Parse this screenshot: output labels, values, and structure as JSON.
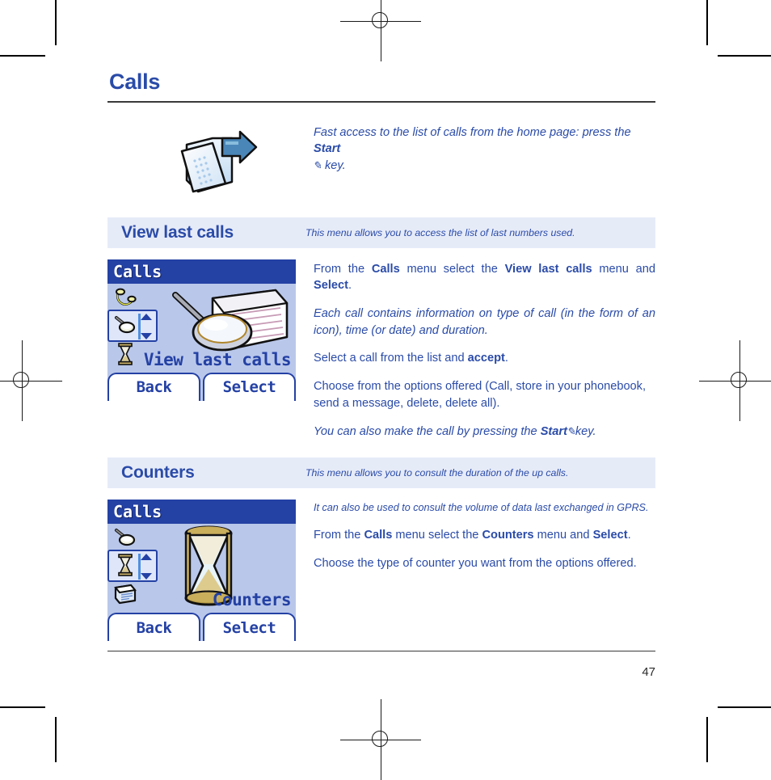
{
  "document": {
    "chapter_title": "Calls",
    "page_number": "47"
  },
  "intro": {
    "icon": "folder-arrow-icon",
    "text_part1": "Fast access to the list of calls from the home page: press the ",
    "text_bold": "Start",
    "text_part2": " ",
    "pen_glyph": "✎",
    "text_part3": " key."
  },
  "sections": [
    {
      "id": "view-last-calls",
      "band_title": "View last calls",
      "band_subtitle": "This menu allows you to access the list of last numbers used.",
      "screen": {
        "title": "Calls",
        "label": "View last calls",
        "rail_icons": [
          "handset-ring-icon",
          "phone-handset-icon",
          "hourglass-icon"
        ],
        "selected_index": 1,
        "center_icon": "magnifier-list-icon",
        "softkey_left": "Back",
        "softkey_right": "Select"
      },
      "paragraphs": [
        {
          "style": "normal-justify",
          "runs": [
            {
              "t": "From the ",
              "b": false
            },
            {
              "t": "Calls",
              "b": true
            },
            {
              "t": " menu select the ",
              "b": false
            },
            {
              "t": "View last calls",
              "b": true
            },
            {
              "t": " menu and ",
              "b": false
            },
            {
              "t": "Select",
              "b": true
            },
            {
              "t": ".",
              "b": false
            }
          ]
        },
        {
          "style": "italic-justify",
          "runs": [
            {
              "t": "Each call contains information on type of call (in the form of an icon), time (or date) and duration.",
              "b": false
            }
          ]
        },
        {
          "style": "normal",
          "runs": [
            {
              "t": "Select a call from the list and ",
              "b": false
            },
            {
              "t": "accept",
              "b": true
            },
            {
              "t": ".",
              "b": false
            }
          ]
        },
        {
          "style": "normal",
          "runs": [
            {
              "t": "Choose from the options offered (Call, store in your phonebook, send a message, delete, delete all).",
              "b": false
            }
          ]
        },
        {
          "style": "italic-key",
          "runs": [
            {
              "t": "You can also make the call by pressing the ",
              "b": false
            },
            {
              "t": "Start",
              "b": true
            },
            {
              "t": " ✎ ",
              "b": false
            },
            {
              "t": "key.",
              "b": false
            }
          ]
        }
      ]
    },
    {
      "id": "counters",
      "band_title": "Counters",
      "band_subtitle": "This menu allows you to consult the duration of the up calls.",
      "screen": {
        "title": "Calls",
        "label": "Counters",
        "rail_icons": [
          "phone-handset-icon",
          "hourglass-icon",
          "notepad-icon"
        ],
        "selected_index": 1,
        "center_icon": "hourglass-icon",
        "softkey_left": "Back",
        "softkey_right": "Select"
      },
      "paragraphs": [
        {
          "style": "italic",
          "runs": [
            {
              "t": "It can also be used to consult the volume of data last exchanged in GPRS.",
              "b": false
            }
          ]
        },
        {
          "style": "normal",
          "runs": [
            {
              "t": "From the ",
              "b": false
            },
            {
              "t": "Calls",
              "b": true
            },
            {
              "t": " menu select the ",
              "b": false
            },
            {
              "t": "Counters",
              "b": true
            },
            {
              "t": " menu and ",
              "b": false
            },
            {
              "t": "Select",
              "b": true
            },
            {
              "t": ".",
              "b": false
            }
          ]
        },
        {
          "style": "normal",
          "runs": [
            {
              "t": "Choose the type of counter you want from the options offered.",
              "b": false
            }
          ]
        }
      ]
    }
  ],
  "colors": {
    "brand_blue": "#2a4ba8",
    "band_bg": "#e6ebf8",
    "screen_bg": "#b9c7ea",
    "screen_titlebar": "#2441a4"
  }
}
